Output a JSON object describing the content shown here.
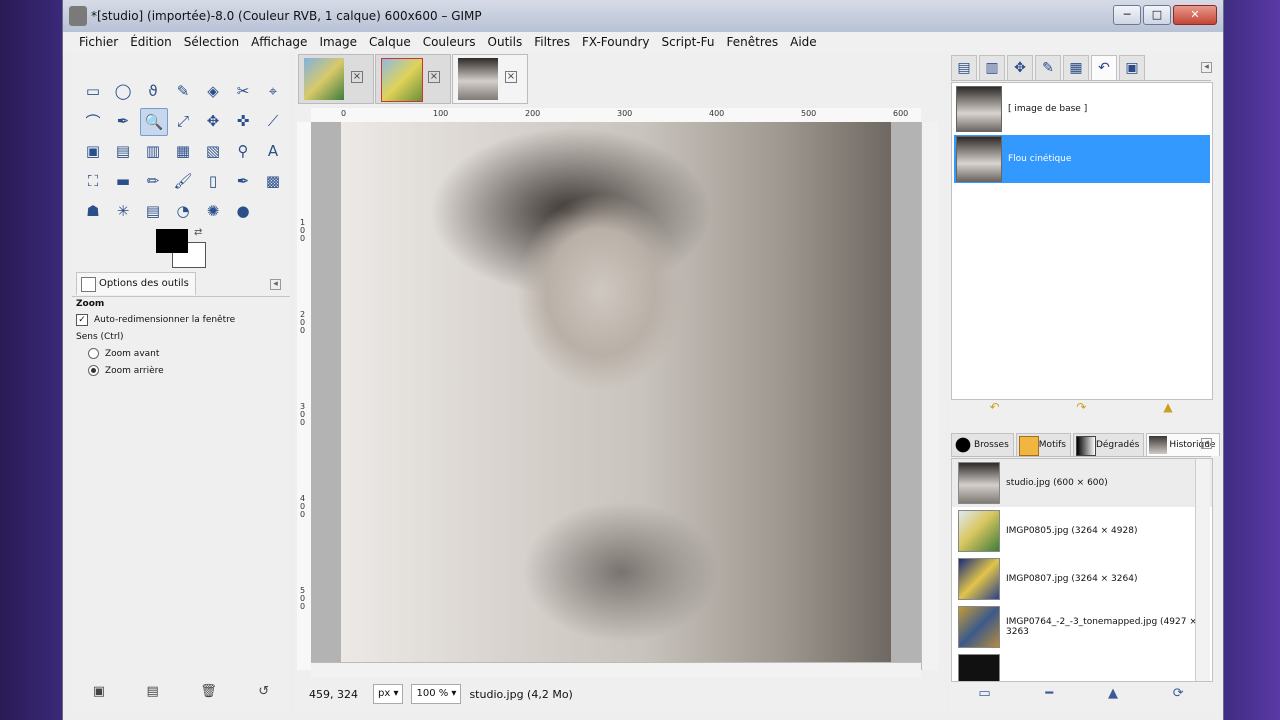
{
  "window": {
    "title": "*[studio] (importée)-8.0 (Couleur RVB, 1 calque) 600x600 – GIMP"
  },
  "window_buttons": {
    "minimize": "─",
    "maximize": "□",
    "close": "✕"
  },
  "menu": [
    "Fichier",
    "Édition",
    "Sélection",
    "Affichage",
    "Image",
    "Calque",
    "Couleurs",
    "Outils",
    "Filtres",
    "FX-Foundry",
    "Script-Fu",
    "Fenêtres",
    "Aide"
  ],
  "toolbox": {
    "tools": [
      "▭",
      "◯",
      "ϑ",
      "✎",
      "◈",
      "✂",
      "⌖",
      "⌒",
      "✒",
      "🔍",
      "⤢",
      "✥",
      "✜",
      "⟋",
      "▣",
      "▤",
      "▥",
      "▦",
      "▧",
      "⚲",
      "A",
      "⛶",
      "▬",
      "✏",
      "🖌",
      "▯",
      "✒",
      "▩",
      "☗",
      "✳",
      "▤",
      "◔",
      "✺",
      "●"
    ],
    "active_index": 9,
    "swap_icon": "⇄",
    "options_tab": "Options des outils",
    "options_title": "Zoom",
    "auto_resize": "Auto-redimensionner la fenêtre",
    "direction_label": "Sens (Ctrl)",
    "zoom_in": "Zoom avant",
    "zoom_out": "Zoom arrière",
    "bottom_icons": [
      "▣",
      "▤",
      "🗑",
      "↺"
    ]
  },
  "image_window": {
    "ruler_top_labels": [
      "0",
      "100",
      "200",
      "300",
      "400",
      "500",
      "600"
    ],
    "ruler_left_labels": [
      "1",
      "0",
      "0",
      "2",
      "0",
      "0",
      "3",
      "0",
      "0",
      "4",
      "0",
      "0",
      "5",
      "0",
      "0"
    ],
    "coords": "459, 324",
    "unit": "px",
    "zoom": "100 %",
    "file_info": "studio.jpg (4,2 Mo)"
  },
  "dock": {
    "tab_icons": [
      "▤",
      "▥",
      "✥",
      "✎",
      "▦",
      "↶",
      "▣"
    ],
    "layers": [
      "[ image de base ]",
      "Flou cinétique"
    ],
    "layer_actions": [
      "↶",
      "↷",
      "▲"
    ],
    "tabs": [
      "Brosses",
      "Motifs",
      "Dégradés",
      "Historique"
    ],
    "history": [
      "studio.jpg (600 × 600)",
      "IMGP0805.jpg (3264 × 4928)",
      "IMGP0807.jpg (3264 × 3264)",
      "IMGP0764_-2_-3_tonemapped.jpg (4927 × 3263",
      ""
    ],
    "bottom_icons": [
      "▭",
      "━",
      "▲",
      "⟳"
    ]
  }
}
